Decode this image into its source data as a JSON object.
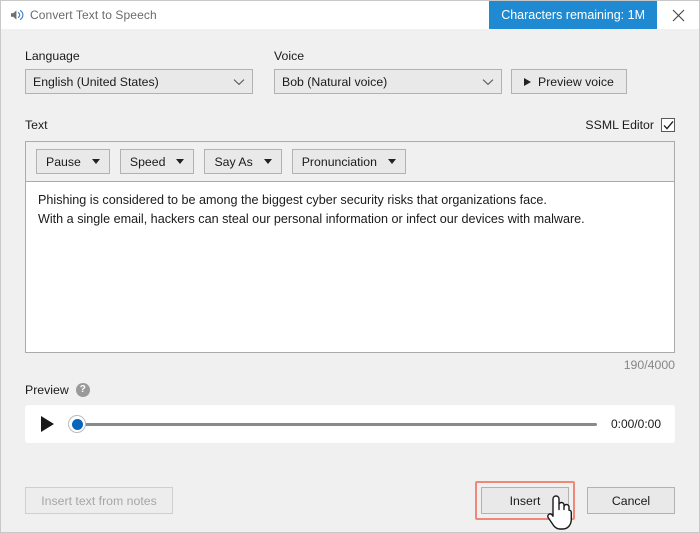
{
  "window": {
    "title": "Convert Text to Speech",
    "icon": "speaker-sound-icon",
    "badge": "Characters remaining: 1M",
    "badge_color": "#1f8ad2",
    "close_icon": "close-icon"
  },
  "language": {
    "label": "Language",
    "value": "English (United States)"
  },
  "voice": {
    "label": "Voice",
    "value": "Bob (Natural voice)",
    "preview_button": "Preview voice"
  },
  "text_section": {
    "label": "Text",
    "ssml_label": "SSML Editor",
    "ssml_checked": true,
    "toolbar": [
      {
        "label": "Pause"
      },
      {
        "label": "Speed"
      },
      {
        "label": "Say As"
      },
      {
        "label": "Pronunciation"
      }
    ],
    "body_lines": [
      "Phishing is considered to be among the biggest cyber security risks that organizations face.",
      "With a single email, hackers can steal our personal information or infect our devices with malware."
    ],
    "char_count": "190/4000"
  },
  "preview": {
    "label": "Preview",
    "help_icon": "help-icon",
    "help_glyph": "?",
    "play_icon": "play-icon",
    "time": "0:00/0:00",
    "progress_percent": 0
  },
  "footer": {
    "insert_notes_label": "Insert text from notes",
    "insert_label": "Insert",
    "cancel_label": "Cancel",
    "highlight_color": "#f08878"
  }
}
